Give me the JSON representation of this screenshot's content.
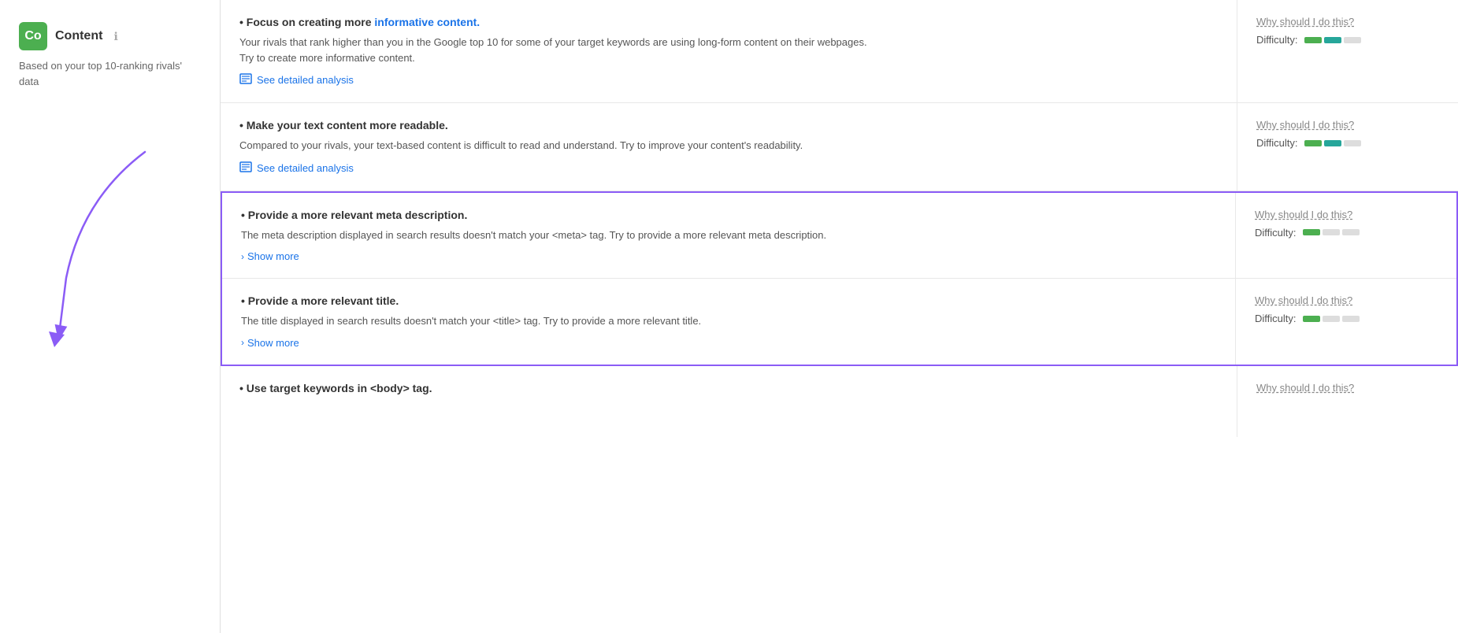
{
  "sidebar": {
    "logo_text": "Co",
    "title": "Content",
    "info_label": "ℹ",
    "subtitle": "Based on your top 10-ranking rivals' data"
  },
  "rows": [
    {
      "id": "row-informative",
      "highlighted": false,
      "title": "Focus on creating more informative content.",
      "title_emphasis": "informative content.",
      "description": "Your rivals that rank higher than you in the Google top 10 for some of your target keywords are using long-form content on their webpages.\nTry to create more informative content.",
      "link_label": "See detailed analysis",
      "link_type": "analysis",
      "why_label": "Why should I do this?",
      "difficulty_label": "Difficulty:",
      "difficulty": [
        {
          "type": "green"
        },
        {
          "type": "teal"
        },
        {
          "type": "gray"
        }
      ]
    },
    {
      "id": "row-readable",
      "highlighted": false,
      "title": "Make your text content more readable.",
      "description": "Compared to your rivals, your text-based content is difficult to read and understand. Try to improve your content's readability.",
      "link_label": "See detailed analysis",
      "link_type": "analysis",
      "why_label": "Why should I do this?",
      "difficulty_label": "Difficulty:",
      "difficulty": [
        {
          "type": "green"
        },
        {
          "type": "teal"
        },
        {
          "type": "gray"
        }
      ]
    },
    {
      "id": "row-meta",
      "highlighted": true,
      "title": "Provide a more relevant meta description.",
      "description": "The meta description displayed in search results doesn't match your <meta> tag. Try to provide a more relevant meta description.",
      "link_label": "Show more",
      "link_type": "show-more",
      "why_label": "Why should I do this?",
      "difficulty_label": "Difficulty:",
      "difficulty": [
        {
          "type": "green"
        },
        {
          "type": "gray"
        },
        {
          "type": "gray"
        }
      ]
    },
    {
      "id": "row-title",
      "highlighted": true,
      "title": "Provide a more relevant title.",
      "description": "The title displayed in search results doesn't match your <title> tag. Try to provide a more relevant title.",
      "link_label": "Show more",
      "link_type": "show-more",
      "why_label": "Why should I do this?",
      "difficulty_label": "Difficulty:",
      "difficulty": [
        {
          "type": "green"
        },
        {
          "type": "gray"
        },
        {
          "type": "gray"
        }
      ]
    },
    {
      "id": "row-keywords",
      "highlighted": false,
      "title": "Use target keywords in <body> tag.",
      "description": "",
      "link_label": "",
      "link_type": "none",
      "why_label": "Why should I do this?",
      "difficulty_label": "",
      "difficulty": []
    }
  ]
}
